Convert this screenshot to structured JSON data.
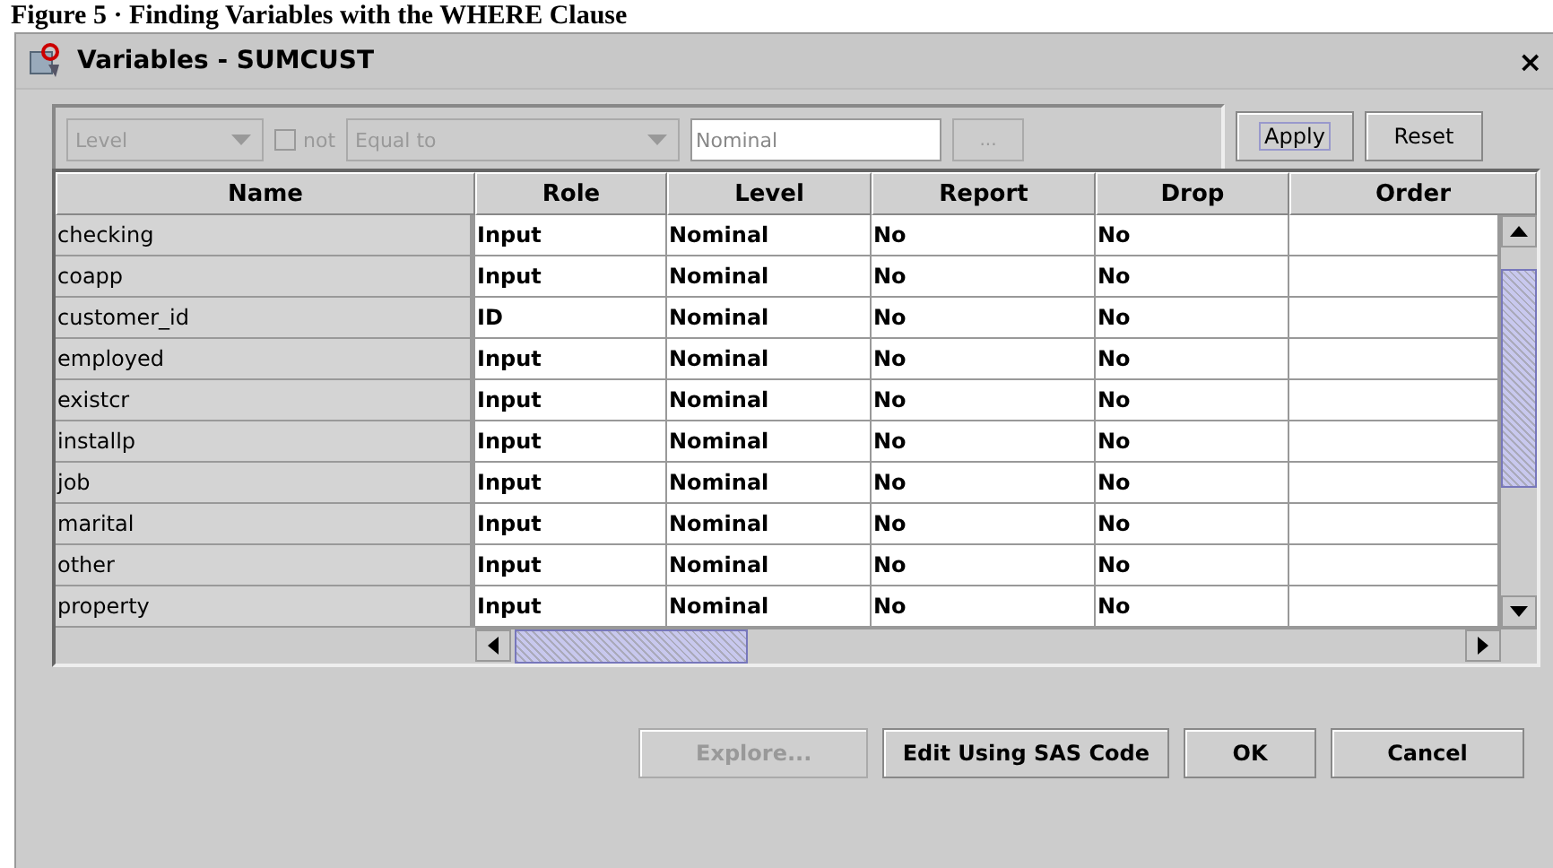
{
  "caption": "Figure 5 · Finding Variables with the WHERE Clause",
  "window": {
    "title": "Variables - SUMCUST",
    "close": "×"
  },
  "filter": {
    "column": {
      "value": "Level",
      "disabled": true
    },
    "not": {
      "label": "not",
      "checked": false,
      "disabled": true
    },
    "operator": {
      "value": "Equal to",
      "disabled": true
    },
    "value": {
      "value": "Nominal"
    },
    "browse": {
      "label": "...",
      "disabled": true
    },
    "buttons": [
      {
        "label": "Apply",
        "focused": true
      },
      {
        "label": "Reset",
        "focused": false
      }
    ]
  },
  "table": {
    "columns": [
      "Name",
      "Role",
      "Level",
      "Report",
      "Drop",
      "Order"
    ],
    "rows": [
      [
        "checking",
        "Input",
        "Nominal",
        "No",
        "No"
      ],
      [
        "coapp",
        "Input",
        "Nominal",
        "No",
        "No"
      ],
      [
        "customer_id",
        "ID",
        "Nominal",
        "No",
        "No"
      ],
      [
        "employed",
        "Input",
        "Nominal",
        "No",
        "No"
      ],
      [
        "existcr",
        "Input",
        "Nominal",
        "No",
        "No"
      ],
      [
        "installp",
        "Input",
        "Nominal",
        "No",
        "No"
      ],
      [
        "job",
        "Input",
        "Nominal",
        "No",
        "No"
      ],
      [
        "marital",
        "Input",
        "Nominal",
        "No",
        "No"
      ],
      [
        "other",
        "Input",
        "Nominal",
        "No",
        "No"
      ],
      [
        "property",
        "Input",
        "Nominal",
        "No",
        "No"
      ]
    ]
  },
  "buttons": [
    {
      "label": "Explore...",
      "disabled": true
    },
    {
      "label": "Edit Using SAS Code",
      "disabled": false
    },
    {
      "label": "OK",
      "disabled": false
    },
    {
      "label": "Cancel",
      "disabled": false
    }
  ]
}
